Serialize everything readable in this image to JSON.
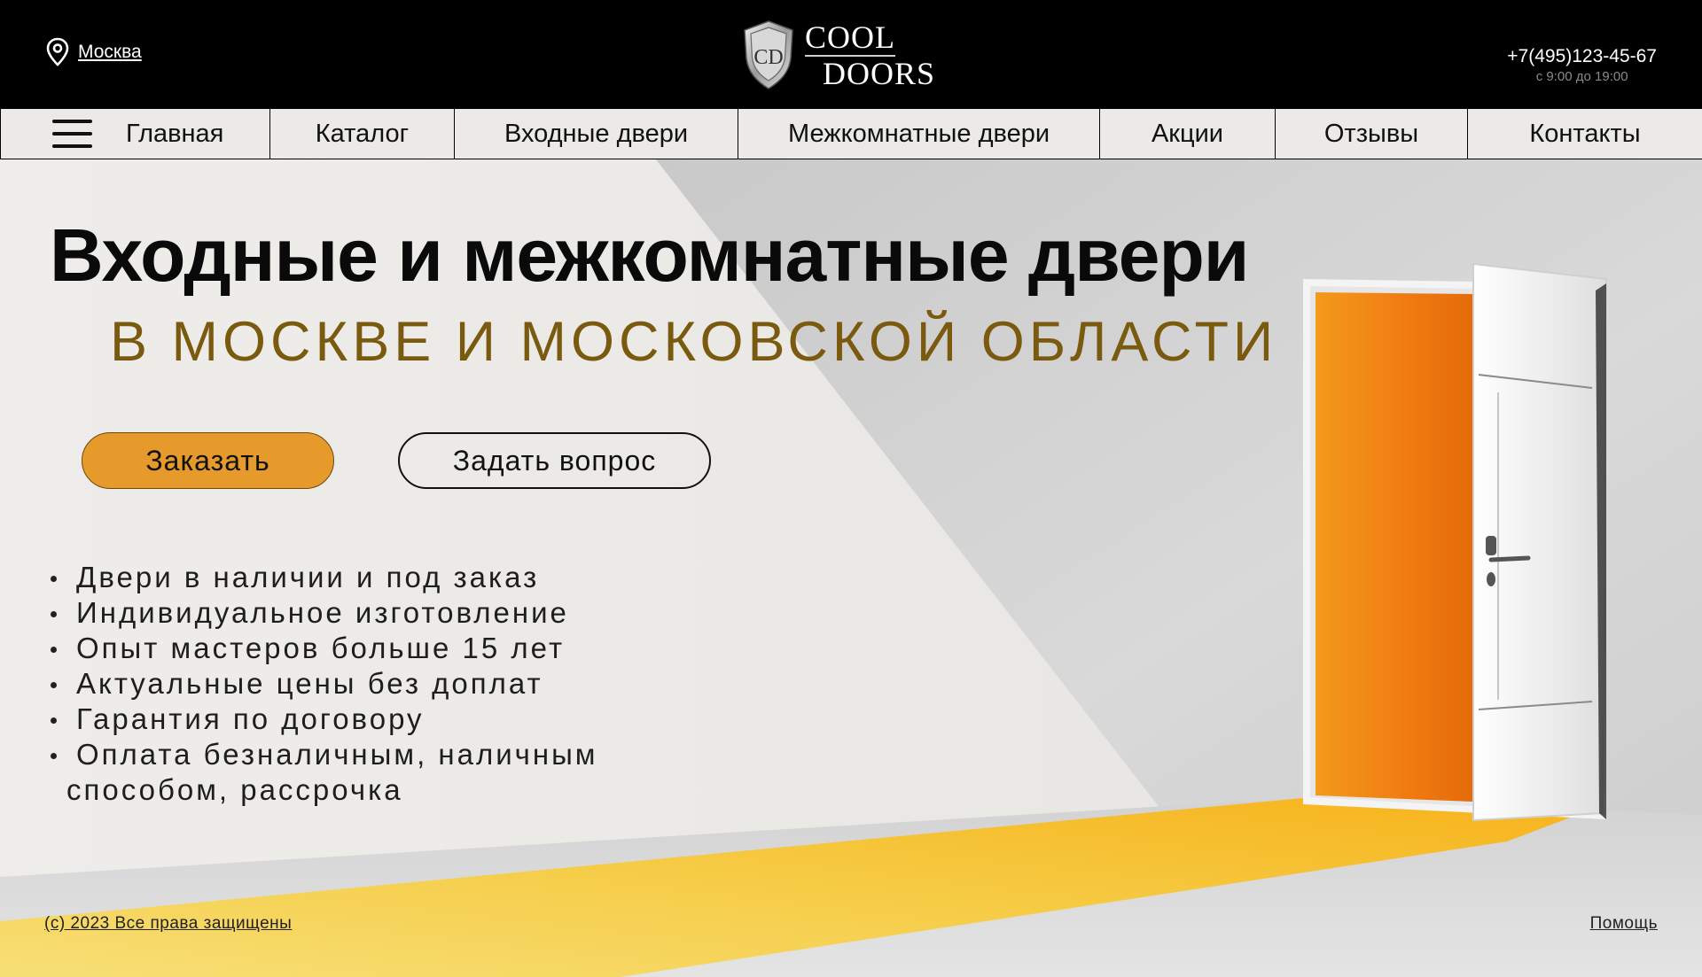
{
  "header": {
    "city": "Москва",
    "logo": {
      "line1": "COOL",
      "line2": "DOORS",
      "monogram": "CD"
    },
    "phone": "+7(495)123-45-67",
    "hours": "с 9:00 до 19:00"
  },
  "nav": {
    "items": [
      {
        "label": "Главная"
      },
      {
        "label": "Каталог"
      },
      {
        "label": "Входные двери"
      },
      {
        "label": "Межкомнатные двери"
      },
      {
        "label": "Акции"
      },
      {
        "label": "Отзывы"
      },
      {
        "label": "Контакты"
      }
    ]
  },
  "hero": {
    "title": "Входные и межкомнатные двери",
    "subtitle": "В МОСКВЕ И МОСКОВСКОЙ ОБЛАСТИ",
    "order_button": "Заказать",
    "ask_button": "Задать вопрос",
    "features": [
      "Двери в наличии и под заказ",
      "Индивидуальное изготовление",
      "Опыт мастеров больше 15 лет",
      "Актуальные цены без доплат",
      "Гарантия по договору"
    ],
    "feature_last_line1": "Оплата безналичным, наличным",
    "feature_last_line2": "способом, рассрочка"
  },
  "footer": {
    "copyright": "(c) 2023 Все права защищены",
    "help": "Помощь"
  },
  "colors": {
    "accent": "#e69a2c",
    "subtitle": "#7a5a0e",
    "header_bg": "#000000",
    "door_inner": "#f07a10"
  },
  "icons": {
    "location": "location-pin-icon",
    "menu": "hamburger-menu-icon",
    "logo": "shield-logo-icon"
  }
}
